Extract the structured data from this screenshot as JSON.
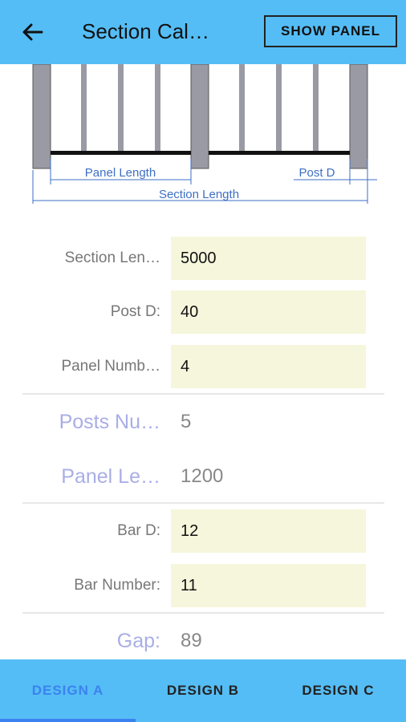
{
  "appbar": {
    "title": "Section Cal…",
    "show_panel": "SHOW PANEL"
  },
  "diagram": {
    "panel_length": "Panel Length",
    "post_d": "Post D",
    "section_length": "Section Length"
  },
  "inputs": [
    {
      "label": "Section Len…",
      "value": "5000"
    },
    {
      "label": "Post D:",
      "value": "40"
    },
    {
      "label": "Panel Numb…",
      "value": "4"
    }
  ],
  "results": [
    {
      "label": "Posts Nu…",
      "value": "5"
    },
    {
      "label": "Panel Le…",
      "value": "1200"
    }
  ],
  "bar_inputs": [
    {
      "label": "Bar D:",
      "value": "12"
    },
    {
      "label": "Bar Number:",
      "value": "11"
    }
  ],
  "gap": {
    "label": "Gap:",
    "value": "89"
  },
  "tabs": [
    {
      "label": "DESIGN A",
      "active": true
    },
    {
      "label": "DESIGN B",
      "active": false
    },
    {
      "label": "DESIGN C",
      "active": false
    }
  ],
  "colors": {
    "bar": "#55bdf5",
    "field": "#f6f6dc",
    "accent": "#3b82f0",
    "result_label": "#a9aee6"
  }
}
